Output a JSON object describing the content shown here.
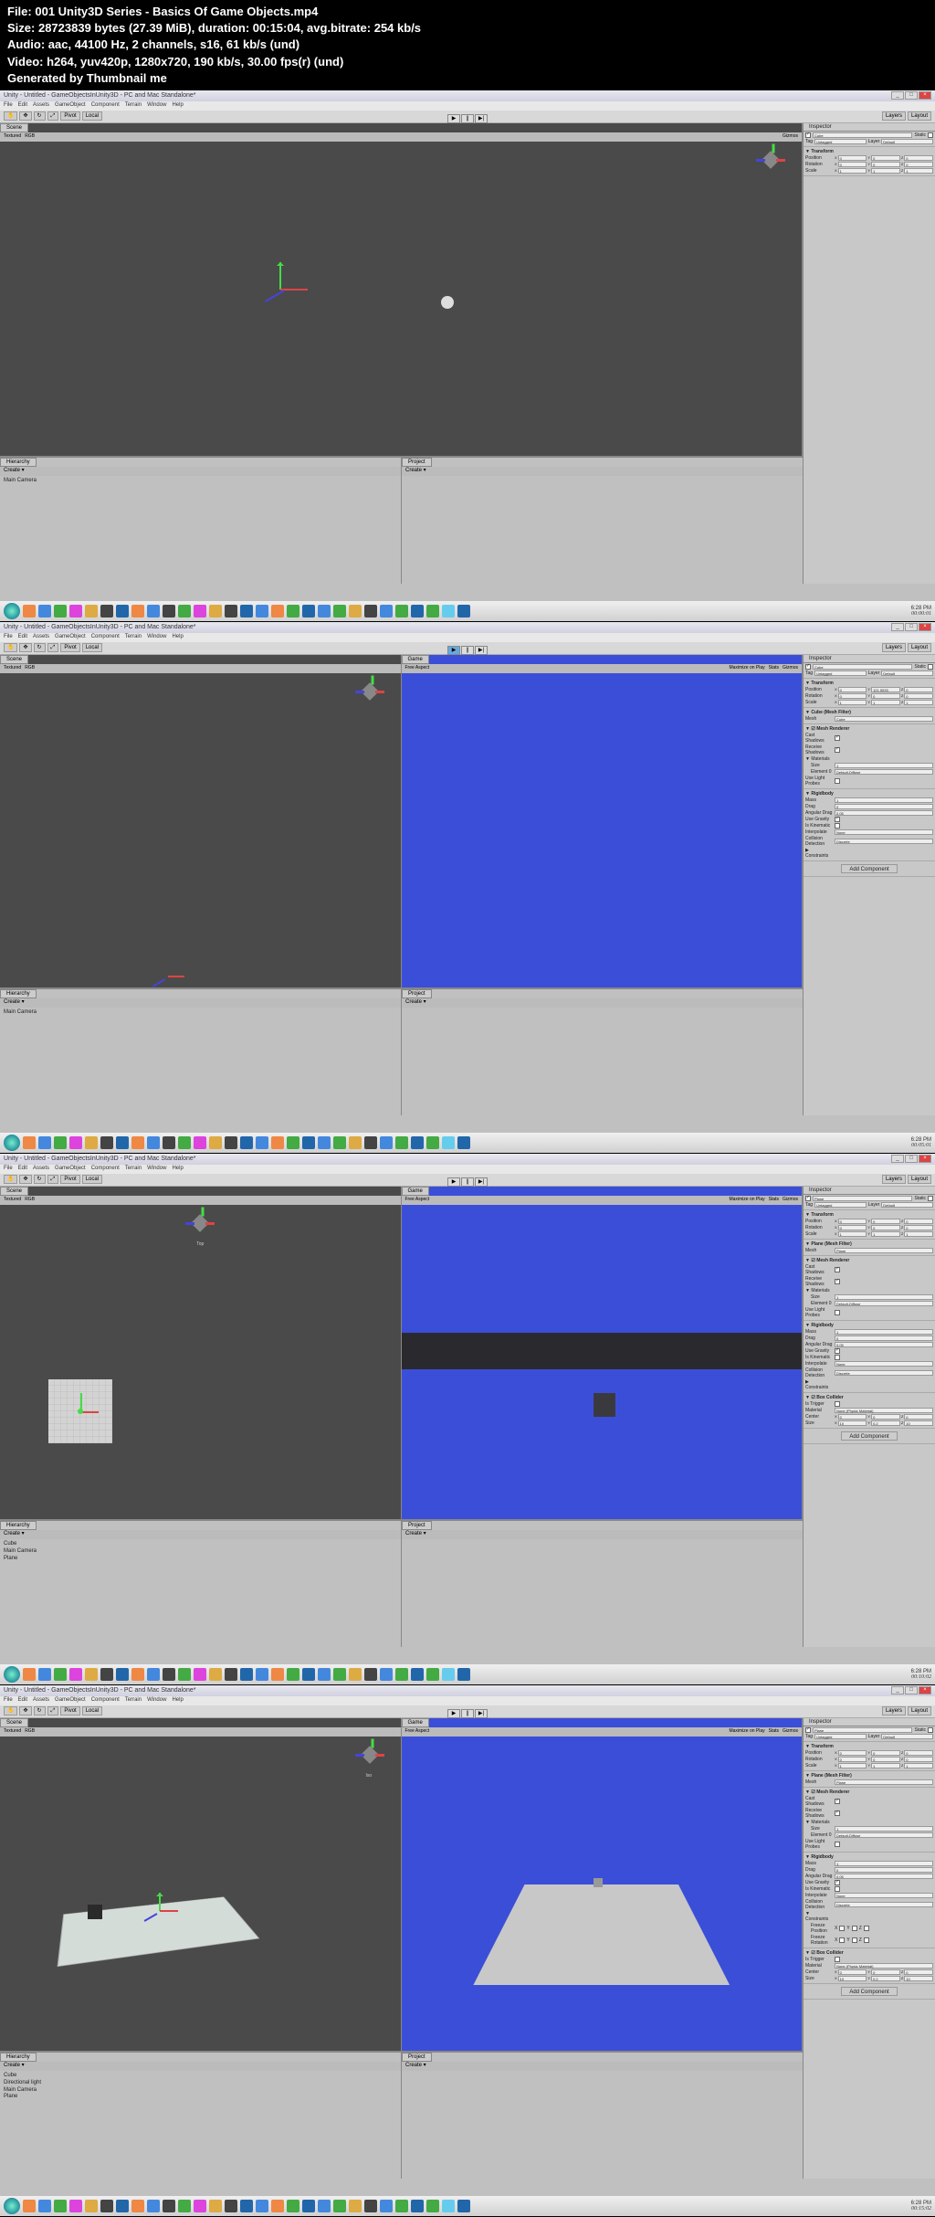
{
  "header": {
    "file_label": "File:",
    "file_value": "001 Unity3D Series - Basics Of Game Objects.mp4",
    "size_label": "Size:",
    "size_value": "28723839 bytes (27.39 MiB), duration: 00:15:04, avg.bitrate: 254 kb/s",
    "audio_label": "Audio:",
    "audio_value": "aac, 44100 Hz, 2 channels, s16, 61 kb/s (und)",
    "video_label": "Video:",
    "video_value": "h264, yuv420p, 1280x720, 190 kb/s, 30.00 fps(r) (und)",
    "generated": "Generated by Thumbnail me"
  },
  "window": {
    "title": "Unity - Untitled - GameObjectsInUnity3D - PC and Mac Standalone*",
    "menu": [
      "File",
      "Edit",
      "Assets",
      "GameObject",
      "Component",
      "Terrain",
      "Window",
      "Help"
    ],
    "toolbar_buttons": [
      "Hand",
      "Move",
      "Rotate",
      "Scale",
      "Pivot",
      "Local"
    ],
    "layers": "Layers",
    "layout": "Layout"
  },
  "panels": {
    "scene": "Scene",
    "game": "Game",
    "hierarchy": "Hierarchy",
    "project": "Project",
    "inspector": "Inspector",
    "create": "Create",
    "textured": "Textured",
    "rgb": "RGB",
    "free_aspect": "Free Aspect",
    "gizmos": "Gizmos",
    "maximize": "Maximize on Play",
    "stats": "Stats"
  },
  "play": {
    "play": "▶",
    "pause": "||",
    "step": "▶|"
  },
  "hierarchy_items": {
    "f1": [
      "Main Camera"
    ],
    "f2": [
      "Main Camera"
    ],
    "f3": [
      "Cube",
      "Main Camera",
      "Plane"
    ],
    "f4": [
      "Cube",
      "Directional light",
      "Main Camera",
      "Plane"
    ]
  },
  "inspector_frames": {
    "f1": {
      "name": "Cube",
      "static": "Static",
      "tag": "Tag",
      "untagged": "Untagged",
      "layer": "Layer",
      "default": "Default",
      "transform": "Transform",
      "position": "Position",
      "rotation": "Rotation",
      "scale": "Scale",
      "px": "0",
      "py": "0",
      "pz": "0",
      "rx": "0",
      "ry": "0",
      "rz": "0",
      "sx": "1",
      "sy": "1",
      "sz": "1"
    },
    "f2": {
      "name": "Cube",
      "static": "Static",
      "tag": "Tag",
      "untagged": "Untagged",
      "layer": "Layer",
      "default": "Default",
      "transform": "Transform",
      "position": "Position",
      "rotation": "Rotation",
      "scale": "Scale",
      "px": "0",
      "py": "121.5533",
      "pz": "0",
      "rx": "0",
      "ry": "0",
      "rz": "0",
      "sx": "1",
      "sy": "1",
      "sz": "1",
      "mesh_filter": "Cube (Mesh Filter)",
      "mesh_lbl": "Mesh",
      "mesh_val": "Cube",
      "mesh_renderer": "Mesh Renderer",
      "cast": "Cast Shadows",
      "recv": "Receive Shadows",
      "materials": "Materials",
      "size": "Size",
      "size_v": "1",
      "elem0": "Element 0",
      "elem0_v": "Default-Diffuse",
      "probes": "Use Light Probes",
      "rigidbody": "Rigidbody",
      "mass": "Mass",
      "mass_v": "1",
      "drag": "Drag",
      "drag_v": "0",
      "ang_drag": "Angular Drag",
      "ang_v": "0.05",
      "gravity": "Use Gravity",
      "kinematic": "Is Kinematic",
      "interp": "Interpolate",
      "interp_v": "None",
      "coll_det": "Collision Detection",
      "coll_v": "Discrete",
      "constraints": "Constraints",
      "add": "Add Component"
    },
    "f3": {
      "name": "Plane",
      "static": "Static",
      "tag": "Tag",
      "untagged": "Untagged",
      "layer": "Layer",
      "default": "Default",
      "transform": "Transform",
      "position": "Position",
      "rotation": "Rotation",
      "scale": "Scale",
      "px": "0",
      "py": "0",
      "pz": "0",
      "rx": "0",
      "ry": "0",
      "rz": "0",
      "sx": "1",
      "sy": "1",
      "sz": "1",
      "mesh_filter": "Plane (Mesh Filter)",
      "mesh_lbl": "Mesh",
      "mesh_val": "Plane",
      "mesh_renderer": "Mesh Renderer",
      "cast": "Cast Shadows",
      "recv": "Receive Shadows",
      "materials": "Materials",
      "size": "Size",
      "size_v": "1",
      "elem0": "Element 0",
      "elem0_v": "Default-Diffuse",
      "probes": "Use Light Probes",
      "rigidbody": "Rigidbody",
      "mass": "Mass",
      "mass_v": "1",
      "drag": "Drag",
      "drag_v": "0",
      "ang_drag": "Angular Drag",
      "ang_v": "0.05",
      "gravity": "Use Gravity",
      "kinematic": "Is Kinematic",
      "interp": "Interpolate",
      "interp_v": "None",
      "coll_det": "Collision Detection",
      "coll_v": "Discrete",
      "constraints": "Constraints",
      "box_collider": "Box Collider",
      "trigger": "Is Trigger",
      "material": "Material",
      "mat_v": "None (Physic Material)",
      "center": "Center",
      "cx": "0",
      "cy": "0",
      "cz": "0",
      "bsize": "Size",
      "bx": "10",
      "by": "0.2",
      "bz": "10",
      "add": "Add Component"
    },
    "f4": {
      "name": "Plane",
      "static": "Static",
      "tag": "Tag",
      "untagged": "Untagged",
      "layer": "Layer",
      "default": "Default",
      "transform": "Transform",
      "position": "Position",
      "rotation": "Rotation",
      "scale": "Scale",
      "px": "0",
      "py": "0",
      "pz": "0",
      "rx": "0",
      "ry": "0",
      "rz": "0",
      "sx": "1",
      "sy": "1",
      "sz": "1",
      "mesh_filter": "Plane (Mesh Filter)",
      "mesh_lbl": "Mesh",
      "mesh_val": "Plane",
      "mesh_renderer": "Mesh Renderer",
      "cast": "Cast Shadows",
      "recv": "Receive Shadows",
      "materials": "Materials",
      "size": "Size",
      "size_v": "1",
      "elem0": "Element 0",
      "elem0_v": "Default-Diffuse",
      "probes": "Use Light Probes",
      "rigidbody": "Rigidbody",
      "mass": "Mass",
      "mass_v": "1",
      "drag": "Drag",
      "drag_v": "0",
      "ang_drag": "Angular Drag",
      "ang_v": "0.05",
      "gravity": "Use Gravity",
      "kinematic": "Is Kinematic",
      "interp": "Interpolate",
      "interp_v": "None",
      "coll_det": "Collision Detection",
      "coll_v": "Discrete",
      "constraints": "Constraints",
      "freeze_pos": "Freeze Position",
      "freeze_rot": "Freeze Rotation",
      "box_collider": "Box Collider",
      "trigger": "Is Trigger",
      "material": "Material",
      "mat_v": "None (Physic Material)",
      "center": "Center",
      "cx": "0",
      "cy": "0",
      "cz": "0",
      "bsize": "Size",
      "bx": "10",
      "by": "0.2",
      "bz": "10",
      "add": "Add Component"
    }
  },
  "taskbar": {
    "time": "6:28 PM",
    "timestamps": [
      "00:00:01",
      "00:05:01",
      "00:10:02",
      "00:15:02"
    ]
  }
}
